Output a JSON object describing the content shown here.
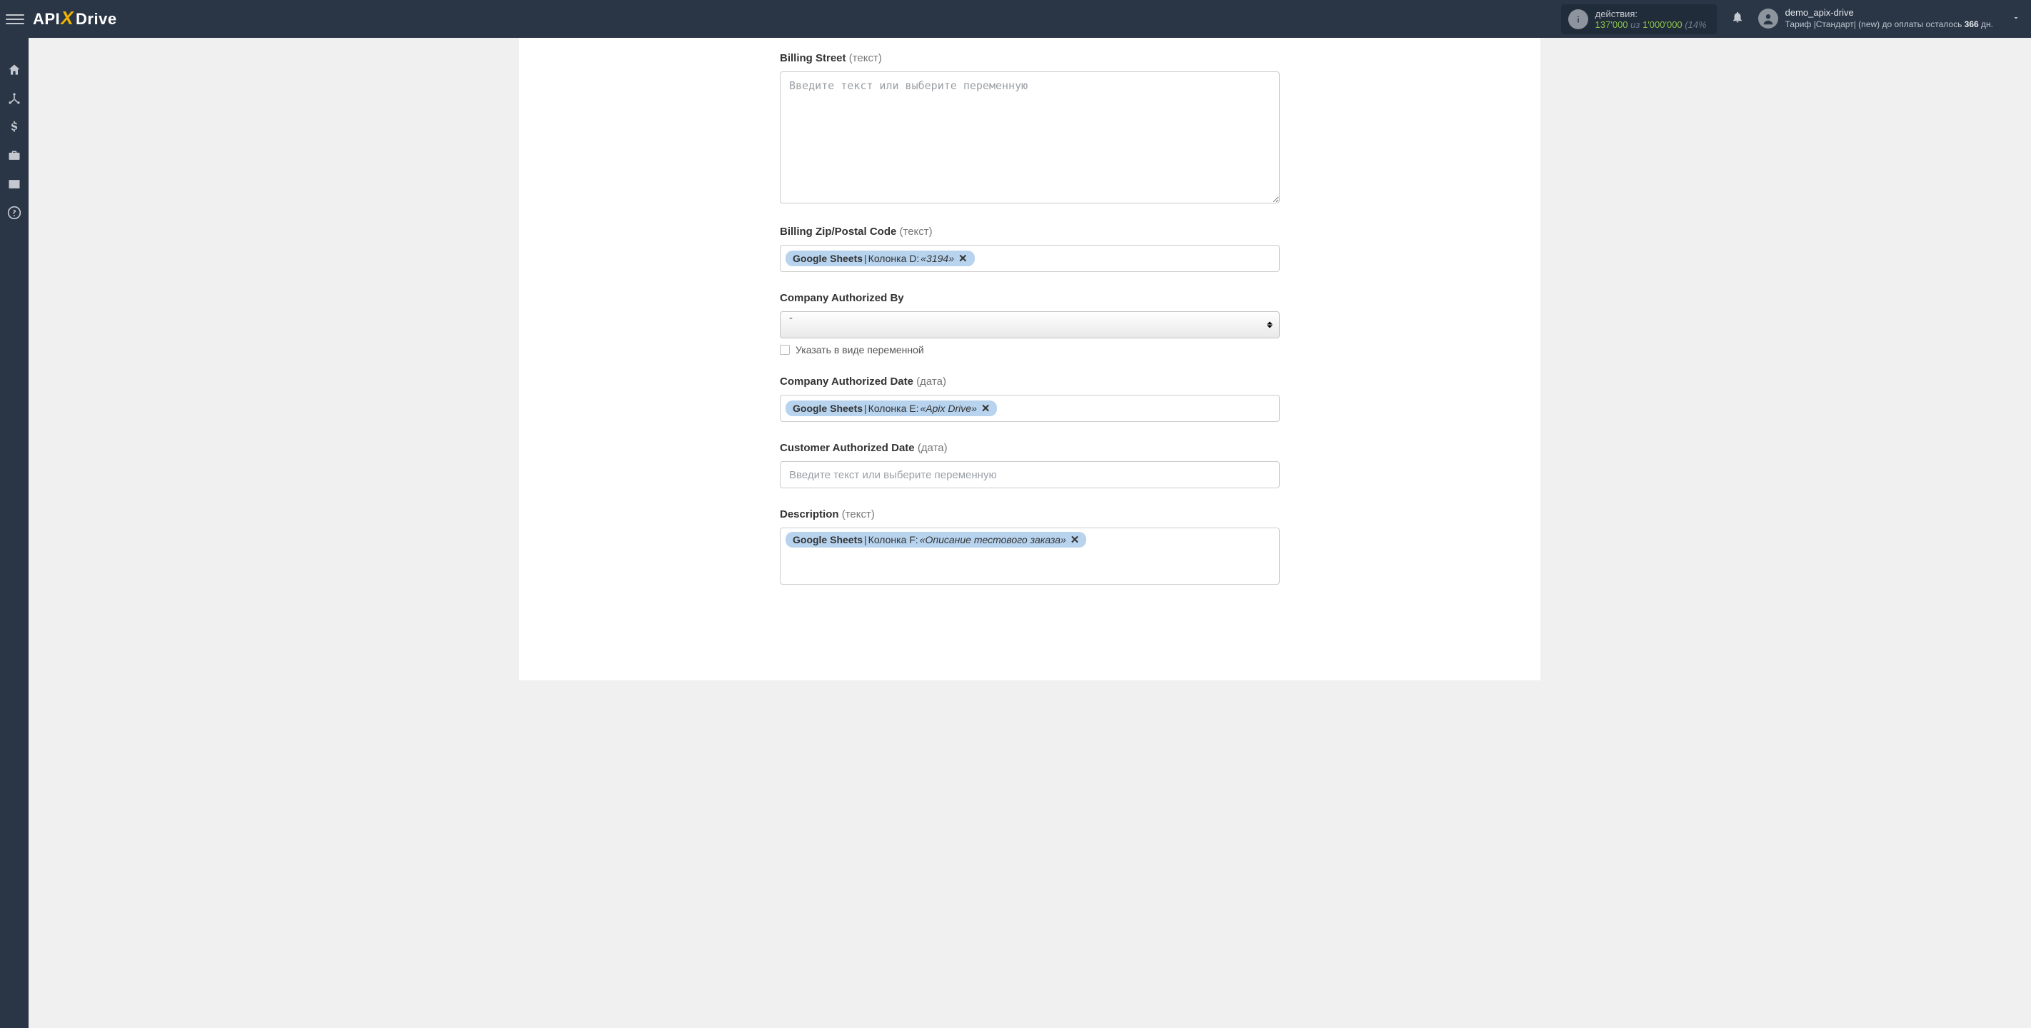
{
  "header": {
    "logo": {
      "api": "API",
      "x": "X",
      "drive": "Drive"
    },
    "actions": {
      "label": "действия:",
      "used": "137'000",
      "iz": "из",
      "total": "1'000'000",
      "pct": "(14%"
    },
    "user": {
      "name": "demo_apix-drive",
      "tariff_prefix": "Тариф |Стандарт| (new) до оплаты осталось ",
      "tariff_days": "366",
      "tariff_suffix": " дн."
    }
  },
  "form": {
    "placeholder_text": "Введите текст или выберите переменную",
    "billing_street": {
      "label": "Billing Street",
      "hint": "(текст)"
    },
    "billing_zip": {
      "label": "Billing Zip/Postal Code",
      "hint": "(текст)",
      "token_source": "Google Sheets",
      "token_sep": " | ",
      "token_col": "Колонка D: ",
      "token_val": "«3194»"
    },
    "company_auth_by": {
      "label": "Company Authorized By",
      "select_value": "-",
      "checkbox_label": "Указать в виде переменной"
    },
    "company_auth_date": {
      "label": "Company Authorized Date",
      "hint": "(дата)",
      "token_source": "Google Sheets",
      "token_sep": " | ",
      "token_col": "Колонка E: ",
      "token_val": "«Apix Drive»"
    },
    "customer_auth_date": {
      "label": "Customer Authorized Date",
      "hint": "(дата)"
    },
    "description": {
      "label": "Description",
      "hint": "(текст)",
      "token_source": "Google Sheets",
      "token_sep": " | ",
      "token_col": "Колонка F: ",
      "token_val": "«Описание тестового заказа»"
    }
  }
}
